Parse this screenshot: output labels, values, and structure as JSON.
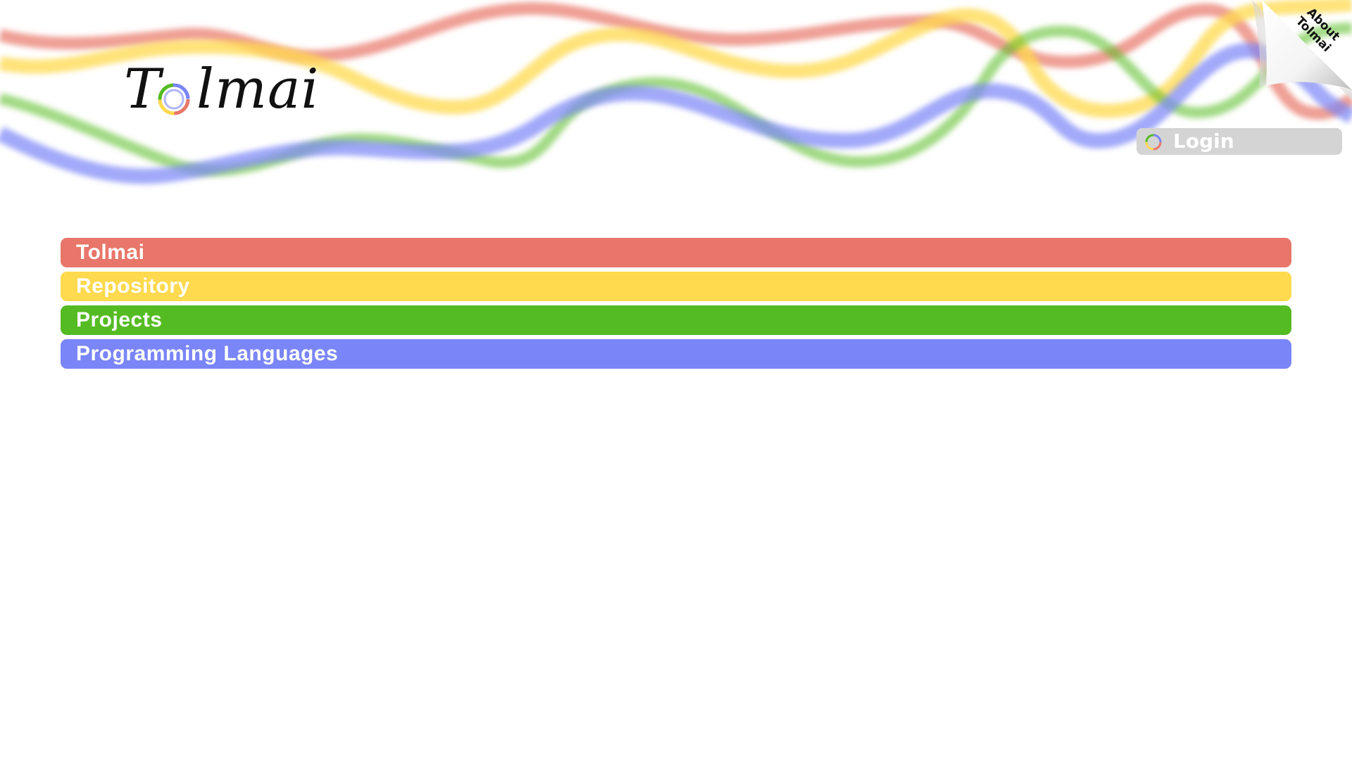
{
  "logo": {
    "text_before": "T",
    "text_after": "lmai",
    "ring_colors": [
      "#e8766a",
      "#ffd94e",
      "#55bb22",
      "#7a85f7"
    ]
  },
  "header": {
    "wave_colors": {
      "red": "#e8766a",
      "yellow": "#ffd94e",
      "green": "#55bb22",
      "blue": "#7a85f7"
    }
  },
  "login": {
    "label": "Login",
    "icon": "ring-logo-icon",
    "background": "#d4d4d4"
  },
  "about": {
    "label_line1": "About",
    "label_line2": "Tolmai",
    "icon": "page-curl-icon"
  },
  "nav": {
    "items": [
      {
        "label": "Tolmai",
        "color": "#e8766a"
      },
      {
        "label": "Repository",
        "color": "#ffd94e"
      },
      {
        "label": "Projects",
        "color": "#55bb22"
      },
      {
        "label": "Programming Languages",
        "color": "#7a85f7"
      }
    ]
  }
}
